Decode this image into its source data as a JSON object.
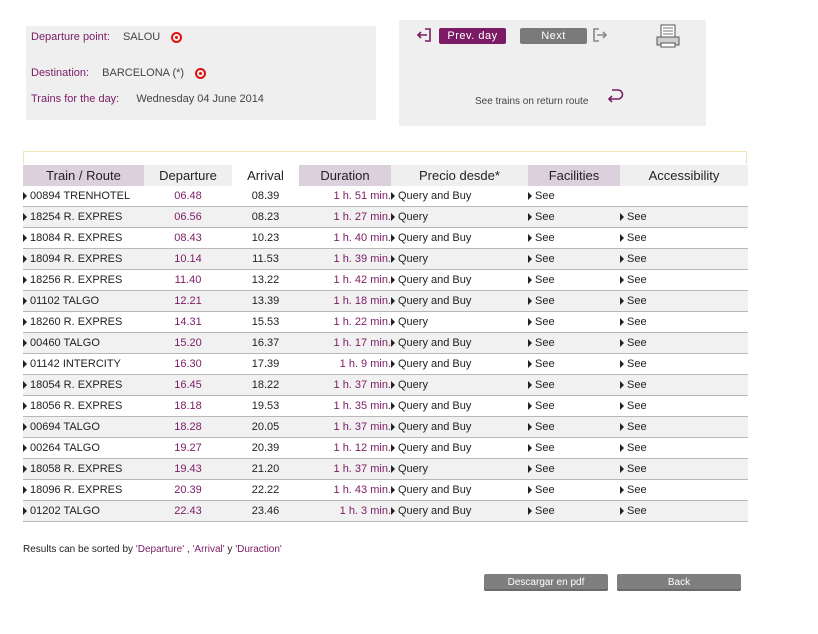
{
  "info": {
    "departure_label": "Departure point:",
    "departure_value": "SALOU",
    "destination_label": "Destination:",
    "destination_value": "BARCELONA (*)",
    "date_label": "Trains for the day:",
    "date_value": "Wednesday  04  June  2014"
  },
  "nav": {
    "prev_label": "Prev. day",
    "next_label": "Next",
    "return_label": "See trains on return route"
  },
  "table": {
    "headers": {
      "route": "Train / Route",
      "departure": "Departure",
      "arrival": "Arrival",
      "duration": "Duration",
      "price": "Precio desde*",
      "facilities": "Facilities",
      "accessibility": "Accessibility"
    },
    "rows": [
      {
        "route": "00894 TRENHOTEL",
        "dep": "06.48",
        "arr": "08.39",
        "dur": "1 h. 51 min.",
        "price": "Query and Buy",
        "fac": "See",
        "acc": ""
      },
      {
        "route": "18254 R. EXPRES",
        "dep": "06.56",
        "arr": "08.23",
        "dur": "1 h. 27 min.",
        "price": "Query",
        "fac": "See",
        "acc": "See"
      },
      {
        "route": "18084 R. EXPRES",
        "dep": "08.43",
        "arr": "10.23",
        "dur": "1 h. 40 min.",
        "price": "Query and Buy",
        "fac": "See",
        "acc": "See"
      },
      {
        "route": "18094 R. EXPRES",
        "dep": "10.14",
        "arr": "11.53",
        "dur": "1 h. 39 min.",
        "price": "Query",
        "fac": "See",
        "acc": "See"
      },
      {
        "route": "18256 R. EXPRES",
        "dep": "11.40",
        "arr": "13.22",
        "dur": "1 h. 42 min.",
        "price": "Query and Buy",
        "fac": "See",
        "acc": "See"
      },
      {
        "route": "01102 TALGO",
        "dep": "12.21",
        "arr": "13.39",
        "dur": "1 h. 18 min.",
        "price": "Query and Buy",
        "fac": "See",
        "acc": "See"
      },
      {
        "route": "18260 R. EXPRES",
        "dep": "14.31",
        "arr": "15.53",
        "dur": "1 h. 22 min.",
        "price": "Query",
        "fac": "See",
        "acc": "See"
      },
      {
        "route": "00460 TALGO",
        "dep": "15.20",
        "arr": "16.37",
        "dur": "1 h. 17 min.",
        "price": "Query and Buy",
        "fac": "See",
        "acc": "See"
      },
      {
        "route": "01142 INTERCITY",
        "dep": "16.30",
        "arr": "17.39",
        "dur": "1 h. 9 min.",
        "price": "Query and Buy",
        "fac": "See",
        "acc": "See"
      },
      {
        "route": "18054 R. EXPRES",
        "dep": "16.45",
        "arr": "18.22",
        "dur": "1 h. 37 min.",
        "price": "Query",
        "fac": "See",
        "acc": "See"
      },
      {
        "route": "18056 R. EXPRES",
        "dep": "18.18",
        "arr": "19.53",
        "dur": "1 h. 35 min.",
        "price": "Query and Buy",
        "fac": "See",
        "acc": "See"
      },
      {
        "route": "00694 TALGO",
        "dep": "18.28",
        "arr": "20.05",
        "dur": "1 h. 37 min.",
        "price": "Query and Buy",
        "fac": "See",
        "acc": "See"
      },
      {
        "route": "00264 TALGO",
        "dep": "19.27",
        "arr": "20.39",
        "dur": "1 h. 12 min.",
        "price": "Query and Buy",
        "fac": "See",
        "acc": "See"
      },
      {
        "route": "18058 R. EXPRES",
        "dep": "19.43",
        "arr": "21.20",
        "dur": "1 h. 37 min.",
        "price": "Query",
        "fac": "See",
        "acc": "See"
      },
      {
        "route": "18096 R. EXPRES",
        "dep": "20.39",
        "arr": "22.22",
        "dur": "1 h. 43 min.",
        "price": "Query and Buy",
        "fac": "See",
        "acc": "See"
      },
      {
        "route": "01202 TALGO",
        "dep": "22.43",
        "arr": "23.46",
        "dur": "1 h. 3 min.",
        "price": "Query and Buy",
        "fac": "See",
        "acc": "See"
      }
    ]
  },
  "note": {
    "prefix": "Results can be sorted by ",
    "departure_link": "'Departure'",
    "sep1": " , ",
    "arrival_link": "'Arrival'",
    "sep2": " y ",
    "duration_link": "'Duraction'"
  },
  "footer": {
    "pdf_label": "Descargar en pdf",
    "back_label": "Back"
  },
  "colors": {
    "accent": "#7b1b65",
    "alert_icon": "#e01010",
    "panel_bg": "#efefef"
  },
  "icons": {
    "info_marker": "red-circle-icon",
    "prev": "exit-door-left-icon",
    "next": "exit-door-right-icon",
    "print": "printer-icon",
    "return": "return-arrow-icon",
    "row_arrow": "triangle-right-icon"
  }
}
